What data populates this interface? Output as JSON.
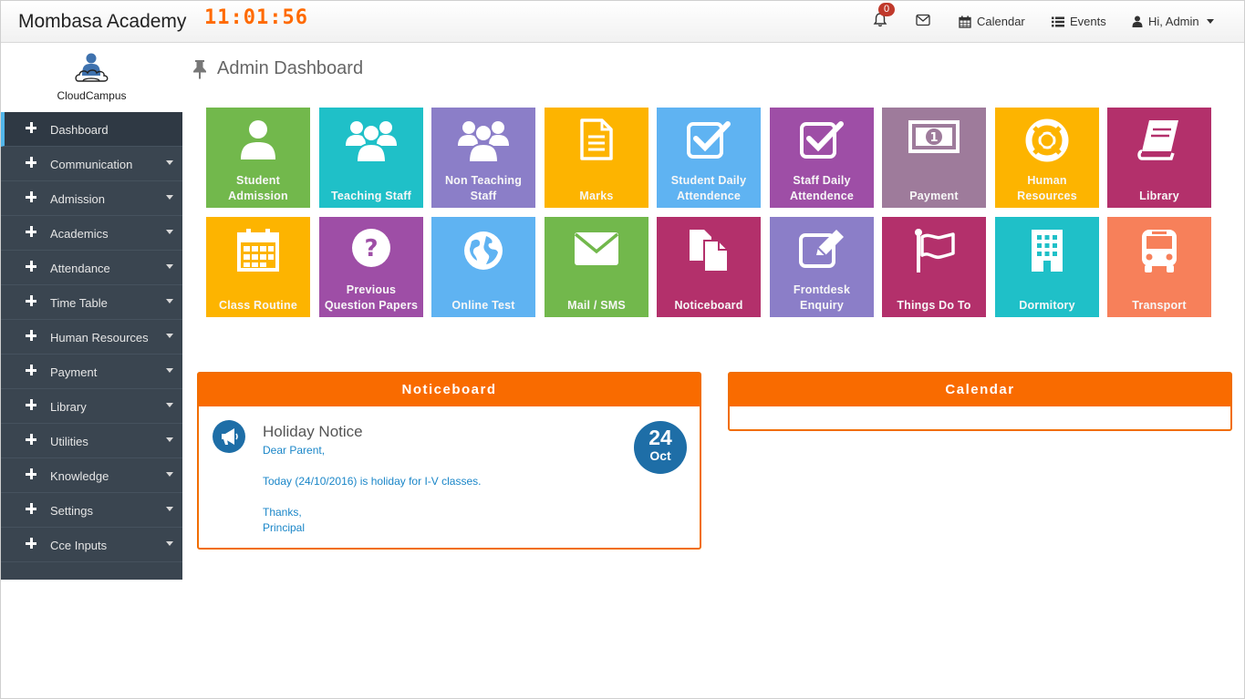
{
  "header": {
    "brand": "Mombasa Academy",
    "clock": "11:01:56",
    "notifications_count": "0",
    "calendar_label": "Calendar",
    "events_label": "Events",
    "user_label": "Hi, Admin"
  },
  "logo": {
    "text": "CloudCampus"
  },
  "sidebar": {
    "items": [
      {
        "label": "Dashboard"
      },
      {
        "label": "Communication"
      },
      {
        "label": "Admission"
      },
      {
        "label": "Academics"
      },
      {
        "label": "Attendance"
      },
      {
        "label": "Time Table"
      },
      {
        "label": "Human Resources"
      },
      {
        "label": "Payment"
      },
      {
        "label": "Library"
      },
      {
        "label": "Utilities"
      },
      {
        "label": "Knowledge"
      },
      {
        "label": "Settings"
      },
      {
        "label": "Cce Inputs"
      }
    ]
  },
  "page": {
    "title": "Admin Dashboard"
  },
  "tiles": [
    {
      "label": "Student Admission",
      "color": "#72b84c",
      "icon": "user-icon"
    },
    {
      "label": "Teaching Staff",
      "color": "#1fc0c8",
      "icon": "users-icon"
    },
    {
      "label": "Non Teaching Staff",
      "color": "#8b7ec8",
      "icon": "users-icon"
    },
    {
      "label": "Marks",
      "color": "#fdb400",
      "icon": "document-icon"
    },
    {
      "label": "Student Daily Attendence",
      "color": "#5fb3f2",
      "icon": "checkbox-icon"
    },
    {
      "label": "Staff Daily Attendence",
      "color": "#9e4ea6",
      "icon": "checkbox-icon"
    },
    {
      "label": "Payment",
      "color": "#9e7b9b",
      "icon": "money-icon"
    },
    {
      "label": "Human Resources",
      "color": "#fdb400",
      "icon": "lifebuoy-icon"
    },
    {
      "label": "Library",
      "color": "#b3306b",
      "icon": "book-icon"
    },
    {
      "label": "Class Routine",
      "color": "#fdb400",
      "icon": "calendar-icon"
    },
    {
      "label": "Previous Question Papers",
      "color": "#9e4ea6",
      "icon": "question-icon"
    },
    {
      "label": "Online Test",
      "color": "#5fb3f2",
      "icon": "globe-icon"
    },
    {
      "label": "Mail / SMS",
      "color": "#72b84c",
      "icon": "envelope-icon"
    },
    {
      "label": "Noticeboard",
      "color": "#b3306b",
      "icon": "files-icon"
    },
    {
      "label": "Frontdesk Enquiry",
      "color": "#8b7ec8",
      "icon": "edit-icon"
    },
    {
      "label": "Things Do To",
      "color": "#b3306b",
      "icon": "flag-icon"
    },
    {
      "label": "Dormitory",
      "color": "#1fc0c8",
      "icon": "building-icon"
    },
    {
      "label": "Transport",
      "color": "#f7805a",
      "icon": "bus-icon"
    }
  ],
  "noticeboard": {
    "heading": "Noticeboard",
    "notice": {
      "title": "Holiday Notice",
      "greeting": "Dear Parent,",
      "body": "Today (24/10/2016) is holiday for I-V classes.",
      "closing": "Thanks,",
      "signature": "Principal",
      "day": "24",
      "month": "Oct"
    }
  },
  "calendar": {
    "heading": "Calendar"
  }
}
